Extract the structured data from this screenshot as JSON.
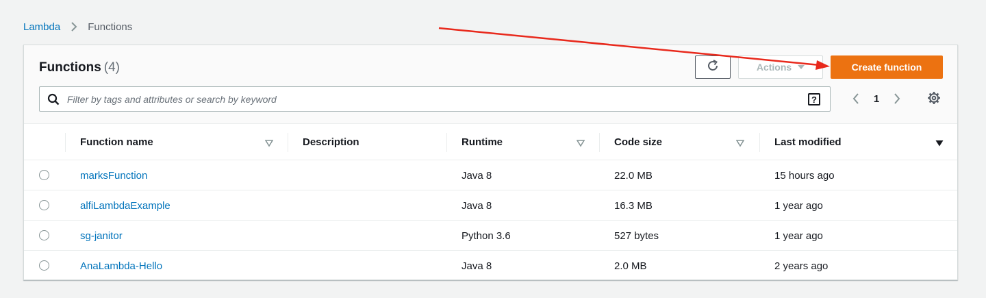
{
  "breadcrumb": {
    "parent": "Lambda",
    "current": "Functions"
  },
  "header": {
    "title": "Functions",
    "count": "(4)",
    "actions_label": "Actions",
    "create_label": "Create function",
    "accent_color": "#ec7211"
  },
  "search": {
    "placeholder": "Filter by tags and attributes or search by keyword",
    "value": ""
  },
  "pagination": {
    "current_page": "1"
  },
  "table": {
    "columns": [
      "Function name",
      "Description",
      "Runtime",
      "Code size",
      "Last modified"
    ],
    "sorted_column": "Last modified",
    "rows": [
      {
        "name": "marksFunction",
        "description": "",
        "runtime": "Java 8",
        "code_size": "22.0 MB",
        "last_modified": "15 hours ago"
      },
      {
        "name": "alfiLambdaExample",
        "description": "",
        "runtime": "Java 8",
        "code_size": "16.3 MB",
        "last_modified": "1 year ago"
      },
      {
        "name": "sg-janitor",
        "description": "",
        "runtime": "Python 3.6",
        "code_size": "527 bytes",
        "last_modified": "1 year ago"
      },
      {
        "name": "AnaLambda-Hello",
        "description": "",
        "runtime": "Java 8",
        "code_size": "2.0 MB",
        "last_modified": "2 years ago"
      }
    ]
  },
  "annotation": {
    "arrow_color": "#e8291c"
  },
  "icons": [
    "chevron-right-icon",
    "refresh-icon",
    "search-icon",
    "help-icon",
    "chevron-left-icon",
    "gear-icon",
    "sort-icon",
    "sort-desc-icon",
    "red-arrow"
  ]
}
